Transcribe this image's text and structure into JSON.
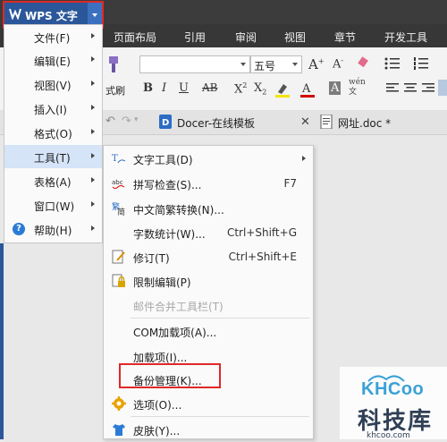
{
  "app": {
    "title": "WPS 文字"
  },
  "ribbon_tabs": [
    "页面布局",
    "引用",
    "审阅",
    "视图",
    "章节",
    "开发工具"
  ],
  "ribbon": {
    "font_size": "五号",
    "format_painter_label": "式刷"
  },
  "doc_tabs": [
    {
      "label": "Docer-在线模板"
    },
    {
      "label": "网址.doc *"
    }
  ],
  "main_menu": [
    {
      "label": "文件(F)"
    },
    {
      "label": "编辑(E)"
    },
    {
      "label": "视图(V)"
    },
    {
      "label": "插入(I)"
    },
    {
      "label": "格式(O)"
    },
    {
      "label": "工具(T)"
    },
    {
      "label": "表格(A)"
    },
    {
      "label": "窗口(W)"
    },
    {
      "label": "帮助(H)"
    }
  ],
  "tools_menu": [
    {
      "label": "文字工具(D)",
      "shortcut": ""
    },
    {
      "label": "拼写检查(S)...",
      "shortcut": "F7"
    },
    {
      "label": "中文简繁转换(N)...",
      "shortcut": ""
    },
    {
      "label": "字数统计(W)...",
      "shortcut": "Ctrl+Shift+G"
    },
    {
      "label": "修订(T)",
      "shortcut": "Ctrl+Shift+E"
    },
    {
      "label": "限制编辑(P)",
      "shortcut": ""
    },
    {
      "label": "邮件合并工具栏(T)",
      "shortcut": ""
    },
    {
      "label": "COM加载项(A)...",
      "shortcut": ""
    },
    {
      "label": "加载项(I)...",
      "shortcut": ""
    },
    {
      "label": "备份管理(K)...",
      "shortcut": ""
    },
    {
      "label": "选项(O)...",
      "shortcut": ""
    },
    {
      "label": "皮肤(Y)...",
      "shortcut": ""
    }
  ],
  "watermark": {
    "brand": "KHCoo",
    "name": "科技库",
    "domain": "khcoo.com"
  },
  "colors": {
    "highlight": "#e02828",
    "menu_active": "#d5e4f7",
    "wps_blue": "#2b579a"
  }
}
